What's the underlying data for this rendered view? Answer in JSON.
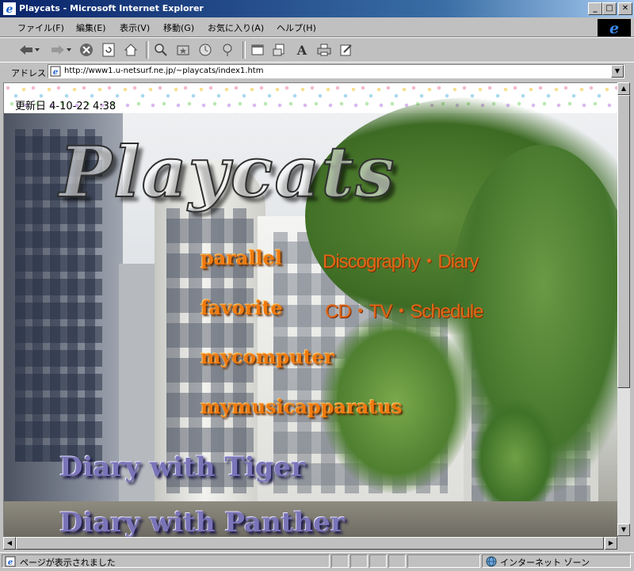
{
  "window": {
    "title": "Playcats - Microsoft Internet Explorer",
    "minimize_icon": "minimize-icon",
    "maximize_icon": "maximize-icon",
    "close_icon": "close-icon"
  },
  "menu": {
    "items": [
      "ファイル(F)",
      "編集(E)",
      "表示(V)",
      "移動(G)",
      "お気に入り(A)",
      "ヘルプ(H)"
    ]
  },
  "toolbar": {
    "icons": [
      "back-icon",
      "forward-icon",
      "stop-icon",
      "refresh-icon",
      "home-icon",
      "search-icon",
      "favorites-icon",
      "history-icon",
      "channels-icon",
      "fullscreen-icon",
      "mail-icon",
      "font-icon",
      "print-icon",
      "edit-icon"
    ]
  },
  "address": {
    "label": "アドレス",
    "url": "http://www1.u-netsurf.ne.jp/~playcats/index1.htm"
  },
  "page": {
    "updated": "更新日 4-10-22  4:38",
    "logo": "Playcats",
    "links": [
      {
        "label": "parallel",
        "sub": "Discography・Diary"
      },
      {
        "label": "favorite",
        "sub": "CD・TV・Schedule"
      },
      {
        "label": "mycomputer",
        "sub": ""
      },
      {
        "label": "mymusicapparatus",
        "sub": ""
      }
    ],
    "diary_links": [
      "Diary with Tiger",
      "Diary with Panther"
    ]
  },
  "status": {
    "text": "ページが表示されました",
    "zone": "インターネット ゾーン"
  },
  "colors": {
    "titlebar": "#0a246a",
    "link_orange": "#f07a10",
    "diary_purple": "#7a74b8"
  }
}
